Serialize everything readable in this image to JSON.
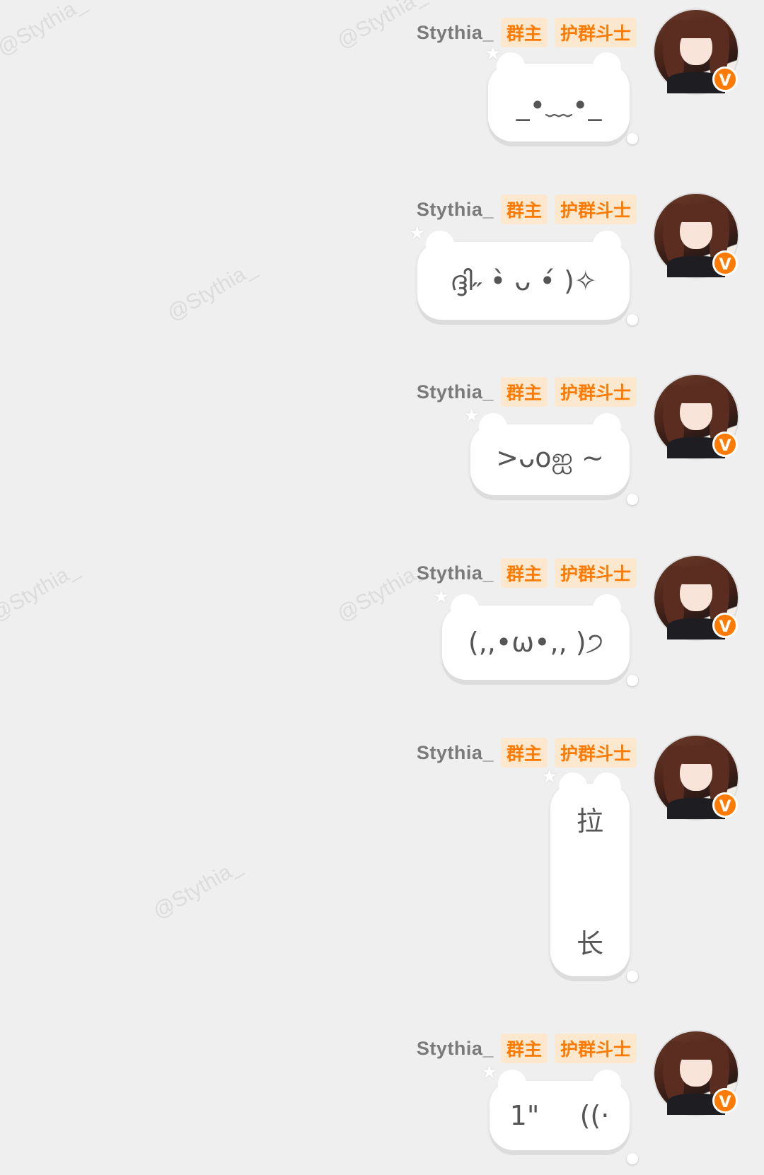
{
  "watermark": "@Stythia_",
  "user": {
    "name": "Stythia_",
    "badge": "V"
  },
  "tags": [
    "群主",
    "护群斗士"
  ],
  "messages": [
    {
      "text": "_•﹏•_"
    },
    {
      "text": "ദ്ദി˶ •̀ ᴗ •́ )✧"
    },
    {
      "text": ">ᴗoஐ ~"
    },
    {
      "text": "(,,•ω•,, )੭"
    },
    {
      "text_top": "拉",
      "text_bottom": "长"
    },
    {
      "text_left": "1\"",
      "text_right": "((·"
    }
  ]
}
